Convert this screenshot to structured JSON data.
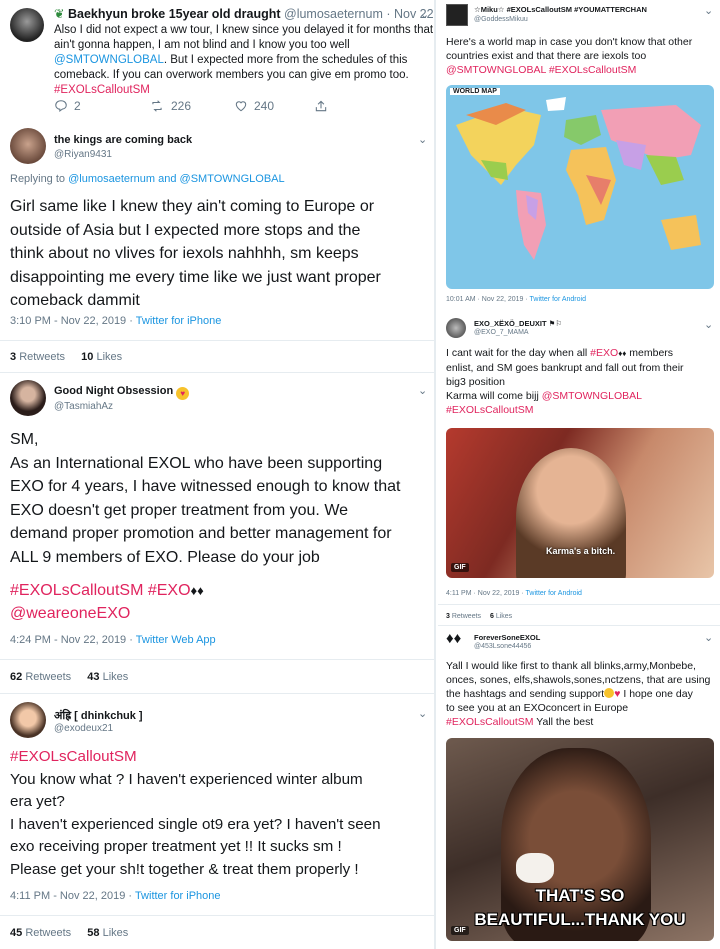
{
  "t1": {
    "name": "Baekhyun broke 15year old draught",
    "handle": "@lumosaeternum",
    "date": "· Nov 22",
    "line1": "Also I did not expect a ww tour, I knew since you delayed it for months that",
    "line2": "ain't gonna happen, I am not blind and I know you too well",
    "mention": "@SMTOWNGLOBAL",
    "line3b": ". But I expected more from the schedules of this",
    "line4": "comeback. If you can overwork members you can give em promo too.",
    "hashtag": "#EXOLsCalloutSM",
    "replies": "2",
    "retweets": "226",
    "likes": "240"
  },
  "t2": {
    "name": "the kings are coming back",
    "handle": "@Riyan9431",
    "replying_prefix": "Replying to ",
    "replying_to": "@lumosaeternum and @SMTOWNGLOBAL",
    "line1": "Girl same like I knew they ain't coming to Europe or",
    "line2": "outside of Asia  but I expected more stops and the",
    "line3": "think about no vlives for iexols nahhhh, sm keeps",
    "line4": "disappointing me every time like we just want proper",
    "line5": "comeback dammit",
    "time": "3:10 PM - Nov 22, 2019 · ",
    "source": "Twitter for iPhone",
    "rt_count": "3",
    "rt_label": "Retweets",
    "like_count": "10",
    "like_label": "Likes"
  },
  "t3": {
    "name": "Good Night Obsession",
    "handle": "@TasmiahAz",
    "line0": "SM,",
    "line1": "As an International EXOL who have been supporting",
    "line2": "EXO for 4 years, I have witnessed enough to know that",
    "line3": "EXO doesn't get proper treatment from you. We",
    "line4": "demand proper promotion and better management for",
    "line5": "ALL 9 members of EXO. Please do your job",
    "hashtags": "#EXOLsCalloutSM #EXO",
    "mention": "@weareoneEXO",
    "time": "4:24 PM - Nov 22, 2019 · ",
    "source": "Twitter Web App",
    "rt_count": "62",
    "rt_label": "Retweets",
    "like_count": "43",
    "like_label": "Likes"
  },
  "t4": {
    "name": "अंह्रि [ dhinkchuk ]",
    "handle": "@exodeux21",
    "hashtag": "#EXOLsCalloutSM",
    "line1": "You know what ? I haven't experienced winter album",
    "line2": "era yet?",
    "line3": "I haven't experienced single ot9 era yet? I haven't seen",
    "line4": "exo receiving proper treatment yet !! It sucks sm !",
    "line5": "Please get your sh!t together & treat them properly !",
    "time": "4:11 PM - Nov 22, 2019 · ",
    "source": "Twitter for iPhone",
    "rt_count": "45",
    "rt_label": "Retweets",
    "like_count": "58",
    "like_label": "Likes"
  },
  "r1": {
    "name": "☆Miku☆ #EXOLsCalloutSM #YOUMATTERCHAN",
    "handle": "@GoddessMikuu",
    "line1": "Here's a world map in case you don't know that other",
    "line2": "countries exist and that there are iexols too",
    "tags": "@SMTOWNGLOBAL #EXOLsCalloutSM",
    "map_title": "WORLD MAP",
    "time": "10:01 AM · Nov 22, 2019 · ",
    "source": "Twitter for Android"
  },
  "r2": {
    "name": "EXO_XËXÖ_DEUXIT",
    "handle": "@EXO_7_MAMA",
    "line1a": "I cant wait for the day when all ",
    "line1tag": "#EXO",
    "line1b": " members",
    "line2": "enlist, and SM goes bankrupt and fall out from their",
    "line3": "big3 position",
    "line4a": "Karma will come bijj ",
    "line4tag": "@SMTOWNGLOBAL",
    "line5": "#EXOLsCalloutSM",
    "gif_caption": "Karma's a bitch.",
    "gif_badge": "GIF",
    "time": "4:11 PM · Nov 22, 2019 · ",
    "source": "Twitter for Android",
    "rt_count": "3",
    "rt_label": "Retweets",
    "like_count": "6",
    "like_label": "Likes"
  },
  "r3": {
    "name": "ForeverSoneEXOL",
    "handle": "@453Lsone44456",
    "line1": "Yall I would like first to thank all blinks,army,Monbebe,",
    "line2": "onces, sones, elfs,shawols,sones,nctzens, that are using",
    "line3a": "the hashtags and sending support",
    "line3b": " I hope one day",
    "line4": "to see you at an EXOconcert in Europe",
    "line5tag": "#EXOLsCalloutSM",
    "line5b": " Yall the best",
    "gif_line1": "THAT'S SO",
    "gif_line2": "BEAUTIFUL...THANK YOU",
    "gif_badge": "GIF"
  }
}
